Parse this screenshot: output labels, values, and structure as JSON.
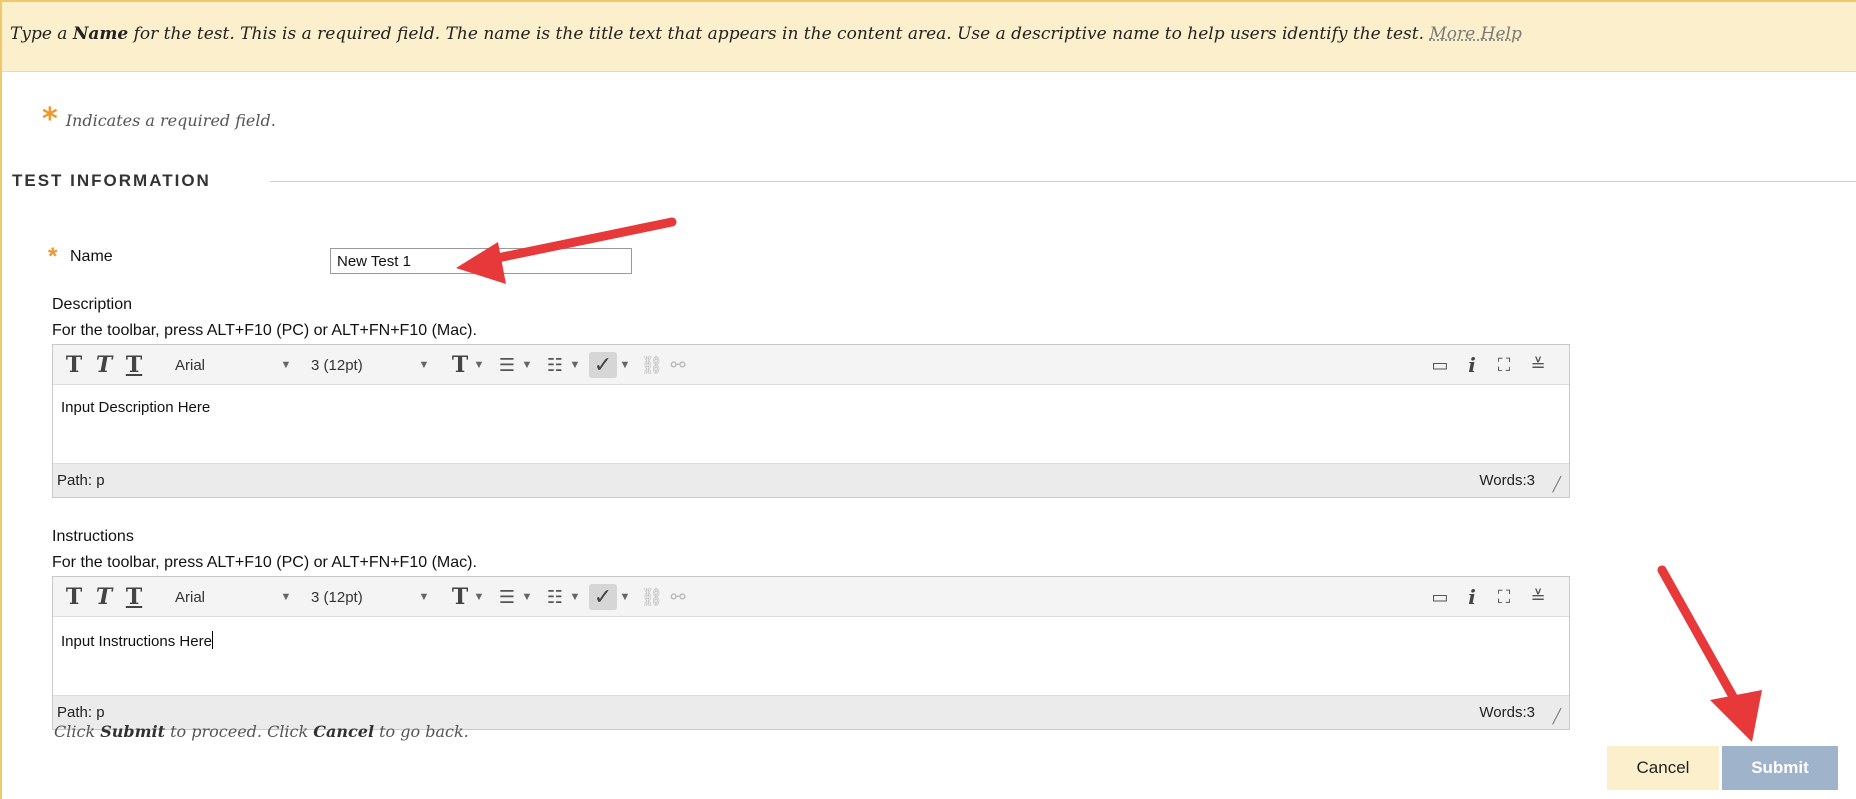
{
  "help_banner": {
    "prefix": "Type a ",
    "bold": "Name",
    "suffix": " for the test. This is a required field. The name is the title text that appears in the content area. Use a descriptive name to help users identify the test.",
    "link": "More Help"
  },
  "required_note": "Indicates a required field.",
  "section_title": "TEST INFORMATION",
  "name_field": {
    "label": "Name",
    "value": "New Test 1"
  },
  "description": {
    "label": "Description",
    "toolbar_hint": "For the toolbar, press ALT+F10 (PC) or ALT+FN+F10 (Mac).",
    "font": "Arial",
    "size": "3 (12pt)",
    "content": "Input Description Here",
    "path": "Path: p",
    "words": "Words:3"
  },
  "instructions": {
    "label": "Instructions",
    "toolbar_hint": "For the toolbar, press ALT+F10 (PC) or ALT+FN+F10 (Mac).",
    "font": "Arial",
    "size": "3 (12pt)",
    "content": "Input Instructions Here",
    "path": "Path: p",
    "words": "Words:3"
  },
  "footer": {
    "note_click1": "Click ",
    "note_submit": "Submit",
    "note_mid": " to proceed. Click ",
    "note_cancel": "Cancel",
    "note_end": " to go back."
  },
  "buttons": {
    "cancel": "Cancel",
    "submit": "Submit"
  },
  "colors": {
    "banner": "#fcf0cc",
    "asterisk": "#f0962a",
    "submit": "#9fb3cb",
    "arrow": "#e8393a"
  },
  "icons": [
    "bold-icon",
    "italic-icon",
    "underline-icon",
    "text-color-icon",
    "bullet-list-icon",
    "numbered-list-icon",
    "spellcheck-icon",
    "link-icon",
    "unlink-icon",
    "preview-icon",
    "info-icon",
    "fullscreen-icon",
    "expand-toolbar-icon"
  ]
}
